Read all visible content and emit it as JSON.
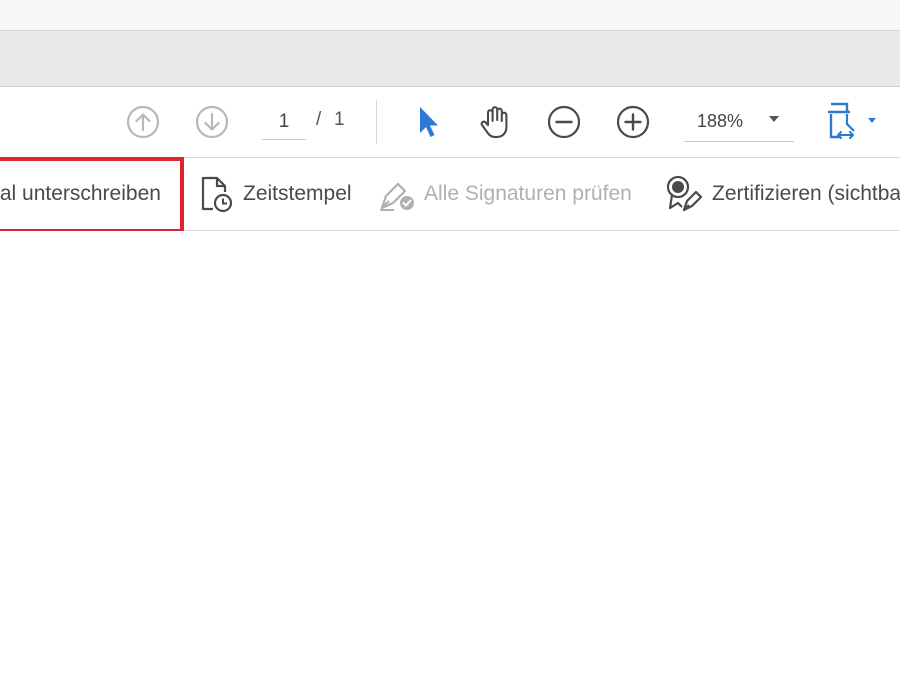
{
  "main_toolbar": {
    "page_current": "1",
    "page_separator": "/",
    "page_total": "1",
    "zoom": "188%",
    "icons": [
      "arrow-up-circle-icon",
      "arrow-down-circle-icon",
      "select-cursor-icon",
      "hand-tool-icon",
      "zoom-out-icon",
      "zoom-in-icon",
      "fit-page-icon",
      "chevron-down-icon"
    ],
    "accent_color": "#2d7ad6"
  },
  "signature_toolbar": {
    "items": [
      {
        "label": "tal unterschreiben",
        "enabled": true
      },
      {
        "label": "Zeitstempel",
        "icon": "timestamp-document-icon",
        "enabled": true
      },
      {
        "label": "Alle Signaturen prüfen",
        "icon": "validate-signatures-icon",
        "enabled": false
      },
      {
        "label": "Zertifizieren (sichtba",
        "icon": "certify-icon",
        "enabled": true
      }
    ],
    "highlight_color": "#e02231"
  }
}
